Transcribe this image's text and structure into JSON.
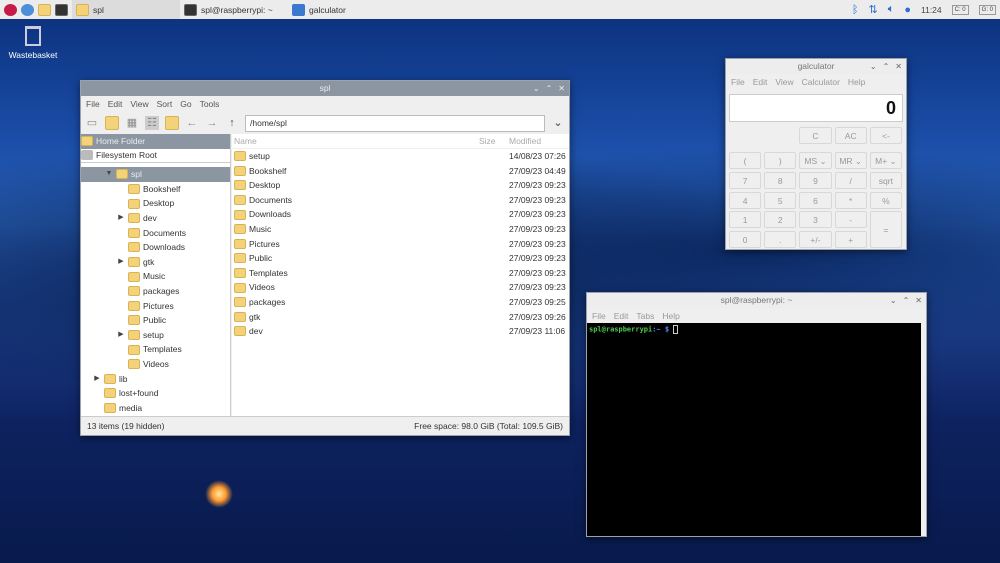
{
  "taskbar": {
    "tasks": [
      {
        "label": "spl",
        "icon": "folder-icon"
      },
      {
        "label": "spl@raspberrypi: ~",
        "icon": "terminal-icon"
      },
      {
        "label": "galculator",
        "icon": "calculator-icon"
      }
    ],
    "clock": "11:24",
    "cpu": "C: 0",
    "gpu": "G: 0"
  },
  "desktop": {
    "wastebasket": "Wastebasket"
  },
  "filemanager": {
    "title": "spl",
    "menu": [
      "File",
      "Edit",
      "View",
      "Sort",
      "Go",
      "Tools"
    ],
    "path": "/home/spl",
    "side_top": [
      {
        "label": "Home Folder"
      },
      {
        "label": "Filesystem Root"
      }
    ],
    "tree": [
      {
        "label": "spl",
        "level": 1,
        "expanded": true,
        "selected": true
      },
      {
        "label": "Bookshelf",
        "level": 2
      },
      {
        "label": "Desktop",
        "level": 2
      },
      {
        "label": "dev",
        "level": 2,
        "arrow": true
      },
      {
        "label": "Documents",
        "level": 2
      },
      {
        "label": "Downloads",
        "level": 2
      },
      {
        "label": "gtk",
        "level": 2,
        "arrow": true
      },
      {
        "label": "Music",
        "level": 2
      },
      {
        "label": "packages",
        "level": 2
      },
      {
        "label": "Pictures",
        "level": 2
      },
      {
        "label": "Public",
        "level": 2
      },
      {
        "label": "setup",
        "level": 2,
        "arrow": true
      },
      {
        "label": "Templates",
        "level": 2
      },
      {
        "label": "Videos",
        "level": 2
      },
      {
        "label": "lib",
        "level": 0,
        "arrow": true
      },
      {
        "label": "lost+found",
        "level": 0
      },
      {
        "label": "media",
        "level": 0
      }
    ],
    "columns": {
      "name": "Name",
      "size": "Size",
      "modified": "Modified"
    },
    "files": [
      {
        "name": "setup",
        "modified": "14/08/23 07:26"
      },
      {
        "name": "Bookshelf",
        "modified": "27/09/23 04:49"
      },
      {
        "name": "Desktop",
        "modified": "27/09/23 09:23"
      },
      {
        "name": "Documents",
        "modified": "27/09/23 09:23"
      },
      {
        "name": "Downloads",
        "modified": "27/09/23 09:23"
      },
      {
        "name": "Music",
        "modified": "27/09/23 09:23"
      },
      {
        "name": "Pictures",
        "modified": "27/09/23 09:23"
      },
      {
        "name": "Public",
        "modified": "27/09/23 09:23"
      },
      {
        "name": "Templates",
        "modified": "27/09/23 09:23"
      },
      {
        "name": "Videos",
        "modified": "27/09/23 09:23"
      },
      {
        "name": "packages",
        "modified": "27/09/23 09:25"
      },
      {
        "name": "gtk",
        "modified": "27/09/23 09:26"
      },
      {
        "name": "dev",
        "modified": "27/09/23 11:06"
      }
    ],
    "status_left": "13 items (19 hidden)",
    "status_right": "Free space: 98.0 GiB (Total: 109.5 GiB)"
  },
  "calculator": {
    "title": "galculator",
    "menu": [
      "File",
      "Edit",
      "View",
      "Calculator",
      "Help"
    ],
    "display": "0",
    "top_buttons": [
      "C",
      "AC",
      "<-"
    ],
    "rows": [
      [
        "(",
        ")",
        "MS ⌄",
        "MR ⌄",
        "M+ ⌄"
      ],
      [
        "7",
        "8",
        "9",
        "/",
        "sqrt"
      ],
      [
        "4",
        "5",
        "6",
        "*",
        "%"
      ],
      [
        "1",
        "2",
        "3",
        "-",
        "="
      ],
      [
        "0",
        ".",
        "+/-",
        "+"
      ]
    ]
  },
  "terminal": {
    "title": "spl@raspberrypi: ~",
    "menu": [
      "File",
      "Edit",
      "Tabs",
      "Help"
    ],
    "prompt_user": "spl@raspberrypi",
    "prompt_path": ":~ $"
  }
}
